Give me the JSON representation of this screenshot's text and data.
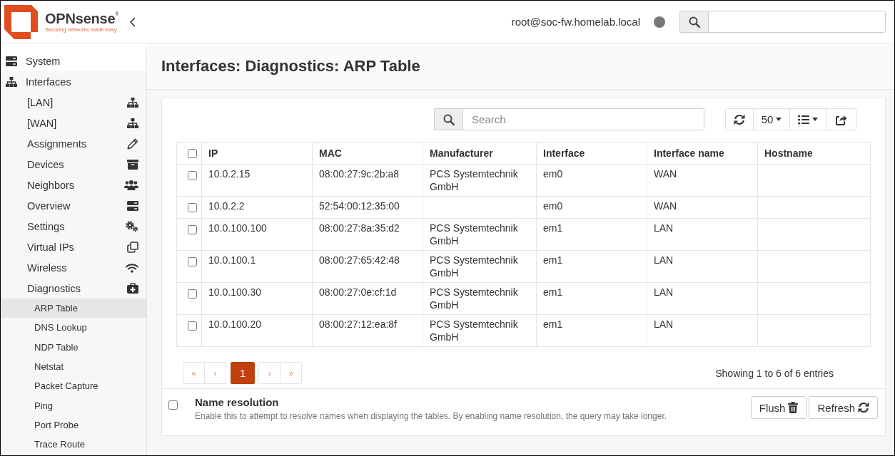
{
  "header": {
    "logo": {
      "name": "OPNsense$^{®}$",
      "tagline": "Securing networks made easy"
    },
    "user": "root@soc-fw.homelab.local"
  },
  "sidebar": {
    "items": [
      {
        "label": "System"
      },
      {
        "label": "Interfaces",
        "children": [
          {
            "label": "[LAN]"
          },
          {
            "label": "[WAN]"
          },
          {
            "label": "Assignments"
          },
          {
            "label": "Devices"
          },
          {
            "label": "Neighbors"
          },
          {
            "label": "Overview"
          },
          {
            "label": "Settings"
          },
          {
            "label": "Virtual IPs"
          },
          {
            "label": "Wireless"
          },
          {
            "label": "Diagnostics",
            "children": [
              {
                "label": "ARP Table",
                "selected": true
              },
              {
                "label": "DNS Lookup",
                "selected": false
              },
              {
                "label": "NDP Table",
                "selected": false
              },
              {
                "label": "Netstat",
                "selected": false
              },
              {
                "label": "Packet Capture",
                "selected": false
              },
              {
                "label": "Ping",
                "selected": false
              },
              {
                "label": "Port Probe",
                "selected": false
              },
              {
                "label": "Trace Route",
                "selected": false
              }
            ]
          }
        ]
      }
    ]
  },
  "page": {
    "title": "Interfaces: Diagnostics: ARP Table"
  },
  "grid": {
    "search": {
      "placeholder": "Search"
    },
    "page_size": "50",
    "columns": [
      "IP",
      "MAC",
      "Manufacturer",
      "Interface",
      "Interface name",
      "Hostname"
    ],
    "select_all": {
      "checked": false
    },
    "rows": [
      {
        "checked": false,
        "ip": "10.0.2.15",
        "mac": "08:00:27:9c:2b:a8",
        "manufacturer": "PCS Systemtechnik GmbH",
        "interface": "em0",
        "interface_name": "WAN"
      },
      {
        "checked": false,
        "ip": "10.0.2.2",
        "mac": "52:54:00:12:35:00",
        "interface": "em0",
        "interface_name": "WAN"
      },
      {
        "checked": false,
        "ip": "10.0.100.100",
        "mac": "08:00:27:8a:35:d2",
        "manufacturer": "PCS Systemtechnik GmbH",
        "interface": "em1",
        "interface_name": "LAN"
      },
      {
        "checked": false,
        "ip": "10.0.100.1",
        "mac": "08:00:27:65:42:48",
        "manufacturer": "PCS Systemtechnik GmbH",
        "interface": "em1",
        "interface_name": "LAN"
      },
      {
        "checked": false,
        "ip": "10.0.100.30",
        "mac": "08:00:27:0e:cf:1d",
        "manufacturer": "PCS Systemtechnik GmbH",
        "interface": "em1",
        "interface_name": "LAN"
      },
      {
        "checked": false,
        "ip": "10.0.100.20",
        "mac": "08:00:27:12:ea:8f",
        "manufacturer": "PCS Systemtechnik GmbH",
        "interface": "em1",
        "interface_name": "LAN"
      }
    ],
    "pages": [
      {
        "label": "«",
        "selected": false
      },
      {
        "label": "‹",
        "selected": false
      },
      {
        "label": "1",
        "selected": true
      },
      {
        "label": "›",
        "selected": false
      },
      {
        "label": "»",
        "selected": false
      }
    ],
    "info": "Showing 1 to 6 of 6 entries"
  },
  "name_resolution": {
    "checked": false,
    "title": "Name resolution",
    "description": "Enable this to attempt to resolve names when displaying the tables. By enabling name resolution, the query may take longer."
  },
  "buttons": [
    {
      "kind": "flush",
      "label": "Flush"
    },
    {
      "kind": "refresh",
      "label": "Refresh"
    }
  ]
}
